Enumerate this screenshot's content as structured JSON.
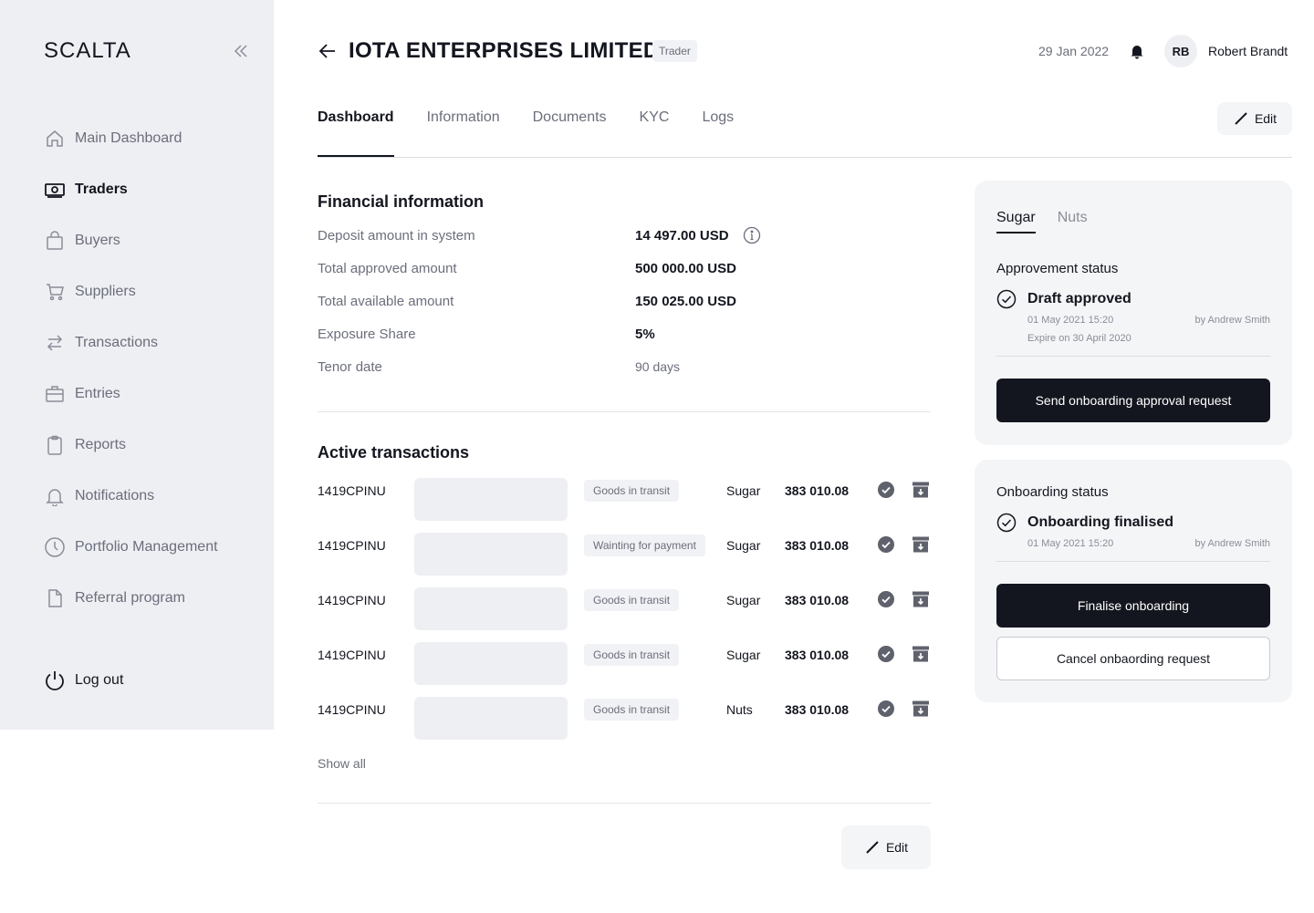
{
  "app": {
    "logo": "SCALTA"
  },
  "sidebar": {
    "items": [
      {
        "label": "Main Dashboard",
        "icon": "home-icon"
      },
      {
        "label": "Traders",
        "icon": "banknote-icon"
      },
      {
        "label": "Buyers",
        "icon": "shopping-bag-icon"
      },
      {
        "label": "Suppliers",
        "icon": "cart-icon"
      },
      {
        "label": "Transactions",
        "icon": "swap-arrows-icon"
      },
      {
        "label": "Entries",
        "icon": "briefcase-icon"
      },
      {
        "label": "Reports",
        "icon": "clipboard-icon"
      },
      {
        "label": "Notifications",
        "icon": "bell-icon"
      },
      {
        "label": "Portfolio Management",
        "icon": "clock-icon"
      },
      {
        "label": "Referral program",
        "icon": "document-icon"
      }
    ],
    "active": "Traders",
    "logout_label": "Log out"
  },
  "header": {
    "title": "IOTA ENTERPRISES LIMITED",
    "role_badge": "Trader",
    "date": "29 Jan 2022",
    "user_initials": "RB",
    "user_name": "Robert Brandt"
  },
  "tabs": [
    "Dashboard",
    "Information",
    "Documents",
    "KYC",
    "Logs"
  ],
  "edit_label": "Edit",
  "financial": {
    "title": "Financial information",
    "rows": [
      {
        "label": "Deposit amount in system",
        "value": "14 497.00 USD"
      },
      {
        "label": "Total approved amount",
        "value": "500 000.00 USD"
      },
      {
        "label": "Total available amount",
        "value": "150 025.00 USD"
      },
      {
        "label": "Exposure Share",
        "value": "5%"
      },
      {
        "label": "Tenor date",
        "value": "90 days"
      }
    ]
  },
  "transactions": {
    "title": "Active transactions",
    "rows": [
      {
        "id": "1419CPINU",
        "status": "Goods in transit",
        "product": "Sugar",
        "amount": "383 010.08"
      },
      {
        "id": "1419CPINU",
        "status": "Wainting for payment",
        "product": "Sugar",
        "amount": "383 010.08"
      },
      {
        "id": "1419CPINU",
        "status": "Goods in transit",
        "product": "Sugar",
        "amount": "383 010.08"
      },
      {
        "id": "1419CPINU",
        "status": "Goods in transit",
        "product": "Sugar",
        "amount": "383 010.08"
      },
      {
        "id": "1419CPINU",
        "status": "Goods in transit",
        "product": "Nuts",
        "amount": "383 010.08"
      }
    ],
    "show_all": "Show all"
  },
  "approval_card": {
    "tabs": [
      "Sugar",
      "Nuts"
    ],
    "label": "Approvement status",
    "status": "Draft approved",
    "date": "01 May 2021  15:20",
    "by": "by Andrew Smith",
    "expire": "Expire on 30 April 2020",
    "button": "Send onboarding approval request"
  },
  "onboarding_card": {
    "label": "Onboarding status",
    "status": "Onboarding finalised",
    "date": "01 May 2021  15:20",
    "by": "by Andrew Smith",
    "primary_button": "Finalise onboarding",
    "secondary_button": "Cancel onbaording request"
  },
  "colors": {
    "dark": "#14161f",
    "sidebar_bg": "#eeeff3",
    "muted": "#6b6e7b"
  }
}
